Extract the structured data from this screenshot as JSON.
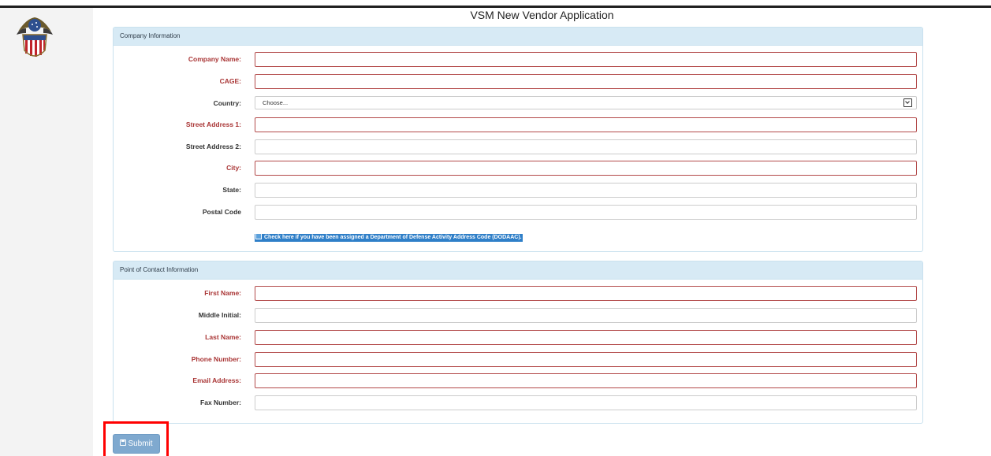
{
  "page": {
    "title": "VSM New Vendor Application"
  },
  "company": {
    "heading": "Company Information",
    "fields": {
      "company_name": "Company Name:",
      "cage": "CAGE:",
      "country": "Country:",
      "street1": "Street Address 1:",
      "street2": "Street Address 2:",
      "city": "City:",
      "state": "State:",
      "postal": "Postal Code"
    },
    "country_selected": "Choose...",
    "dodaac_label": "Check here if you have been assigned a Department of Defense Activity Address Code (DODAAC)."
  },
  "contact": {
    "heading": "Point of Contact Information",
    "fields": {
      "first_name": "First Name:",
      "middle_initial": "Middle Initial:",
      "last_name": "Last Name:",
      "phone": "Phone Number:",
      "email": "Email Address:",
      "fax": "Fax Number:"
    }
  },
  "actions": {
    "submit": "Submit"
  },
  "icons": {
    "logo": "dla-seal-logo",
    "submit": "floppy-disk-icon",
    "select": "chevron-down-icon",
    "checkbox": "checkbox-icon"
  },
  "colors": {
    "required_label": "#a93535",
    "required_border": "#b34a4a",
    "panel_heading_bg": "#d7eaf5",
    "submit_bg": "#7fa9cf",
    "highlight": "#ff0000",
    "dodaac_bg": "#2f7fc8"
  }
}
